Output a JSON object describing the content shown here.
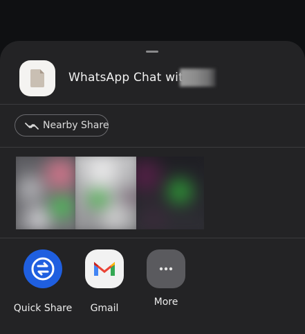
{
  "share_sheet": {
    "title": "WhatsApp Chat with",
    "nearby_share": {
      "label": "Nearby Share",
      "icon": "nearby-share-icon"
    },
    "apps": [
      {
        "label": "Quick Share",
        "icon": "quick-share-icon",
        "color": "#1f5fe0"
      },
      {
        "label": "Gmail",
        "icon": "gmail-icon"
      },
      {
        "label": "More",
        "icon": "more-dots-icon"
      }
    ]
  }
}
